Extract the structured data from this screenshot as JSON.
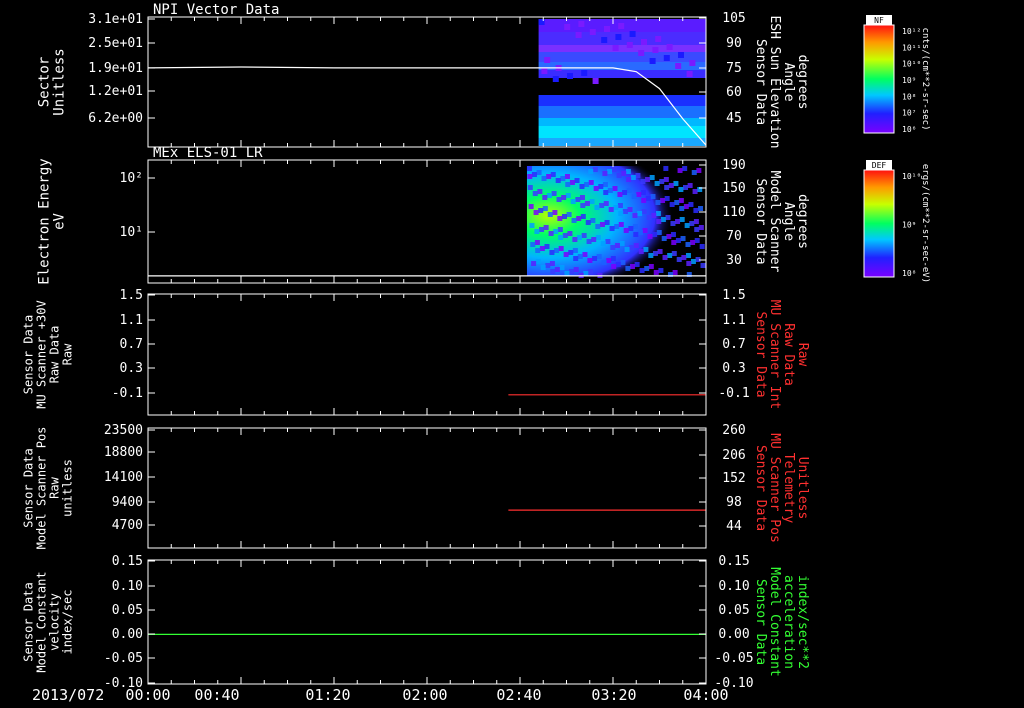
{
  "date_label": "2013/072",
  "x_axis": {
    "ticks": [
      "00:00",
      "00:40",
      "01:20",
      "02:00",
      "02:40",
      "03:20",
      "04:00"
    ],
    "range_min": [
      0,
      240
    ]
  },
  "colors": {
    "background": "#000000",
    "axis": "#ffffff",
    "red_trace": "#ff3030",
    "green_trace": "#33ff33"
  },
  "panels": [
    {
      "id": "npi",
      "title": "NPI Vector Data",
      "left_label": [
        "Sector",
        "Unitless"
      ],
      "left_ticks": [
        "3.1e+01",
        "2.5e+01",
        "1.9e+01",
        "1.2e+01",
        "6.2e+00"
      ],
      "right_ticks": [
        "105",
        "90",
        "75",
        "60",
        "45"
      ],
      "right_label": [
        "Sensor Data",
        "ESH Sun Elevation",
        "Angle",
        "degrees"
      ],
      "right_label_color": "#ffffff"
    },
    {
      "id": "els",
      "title": "MEx ELS-01 LR",
      "left_label": [
        "Electron Energy",
        "eV"
      ],
      "left_ticks": [
        "10²",
        "10¹"
      ],
      "right_ticks": [
        "190",
        "150",
        "110",
        "70",
        "30"
      ],
      "right_label": [
        "Sensor Data",
        "Model Scanner",
        "Angle",
        "degrees"
      ],
      "right_label_color": "#ffffff"
    },
    {
      "id": "mu_raw",
      "title": "",
      "left_label": [
        "Sensor Data",
        "MU Scanner +30V",
        "Raw Data",
        "Raw"
      ],
      "left_ticks": [
        "1.5",
        "1.1",
        "0.7",
        "0.3",
        "-0.1"
      ],
      "right_ticks": [
        "1.5",
        "1.1",
        "0.7",
        "0.3",
        "-0.1"
      ],
      "right_label": [
        "Sensor Data",
        "MU Scanner Int",
        "Raw Data",
        "Raw"
      ],
      "right_label_color": "#ff3030"
    },
    {
      "id": "mu_pos",
      "title": "",
      "left_label": [
        "Sensor Data",
        "Model Scanner Pos",
        "Raw",
        "unitless"
      ],
      "left_ticks": [
        "23500",
        "18800",
        "14100",
        "9400",
        "4700"
      ],
      "right_ticks": [
        "260",
        "206",
        "152",
        "98",
        "44"
      ],
      "right_label": [
        "Sensor Data",
        "MU Scanner Pos",
        "Telemetry",
        "Unitless"
      ],
      "right_label_color": "#ff3030"
    },
    {
      "id": "model",
      "title": "",
      "left_label": [
        "Sensor Data",
        "Model Constant",
        "velocity",
        "index/sec"
      ],
      "left_ticks": [
        "0.15",
        "0.10",
        "0.05",
        "0.00",
        "-0.05",
        "-0.10"
      ],
      "right_ticks": [
        "0.15",
        "0.10",
        "0.05",
        "0.00",
        "-0.05",
        "-0.10"
      ],
      "right_label": [
        "Sensor Data",
        "Model Constant",
        "acceleration",
        "index/sec**2"
      ],
      "right_label_color": "#33ff33"
    }
  ],
  "colorbars": [
    {
      "id": "nf",
      "title": "NF",
      "ticks": [
        "10¹²",
        "10¹¹",
        "10¹⁰",
        "10⁹",
        "10⁸",
        "10⁷",
        "10⁶"
      ],
      "unit": "cnts/(cm**2-sr-sec)"
    },
    {
      "id": "def",
      "title": "DEF",
      "ticks": [
        "10¹⁰",
        "10⁹",
        "10⁸"
      ],
      "unit": "ergs/(cm**2-sr-sec-eV)"
    }
  ],
  "chart_data": [
    {
      "type": "heatmap",
      "title": "NPI Vector Data",
      "ylabel": "Sector Unitless",
      "y_ticks": [
        31,
        25,
        19,
        12,
        6.2
      ],
      "data_start_min": 168,
      "colorbar": "NF",
      "overlay": {
        "name": "ESH Sun Elevation Angle",
        "x_min": [
          0,
          40,
          80,
          120,
          160,
          200,
          210,
          220,
          230,
          240
        ],
        "y_deg": [
          79,
          79.5,
          79,
          79,
          79,
          79,
          77,
          68,
          52,
          38
        ]
      }
    },
    {
      "type": "heatmap",
      "title": "MEx ELS-01 LR",
      "ylabel": "Electron Energy eV",
      "yscale": "log",
      "y_ticks": [
        100,
        10
      ],
      "data_start_min": 163,
      "colorbar": "DEF",
      "overlay": {
        "name": "Model Scanner Angle",
        "x_min": [
          0,
          240
        ],
        "y_deg": [
          11,
          11
        ]
      }
    },
    {
      "type": "line",
      "ylabel": "MU Scanner +30V Raw Data",
      "ylim": [
        -0.3,
        1.5
      ],
      "series": [
        {
          "name": "MU Scanner Int Raw Data",
          "x_min": [
            155,
            240
          ],
          "y": [
            0.0,
            0.0
          ]
        }
      ]
    },
    {
      "type": "line",
      "ylabel": "Model Scanner Pos Raw",
      "ylim": [
        0,
        23500
      ],
      "series": [
        {
          "name": "MU Scanner Pos Telemetry",
          "x_min": [
            155,
            240
          ],
          "y_right": [
            82,
            82
          ]
        }
      ]
    },
    {
      "type": "line",
      "ylabel": "Model Constant velocity",
      "ylim": [
        -0.1,
        0.15
      ],
      "series": [
        {
          "name": "Model Constant acceleration",
          "x_min": [
            0,
            240
          ],
          "y": [
            0.0,
            0.0
          ]
        }
      ]
    }
  ]
}
